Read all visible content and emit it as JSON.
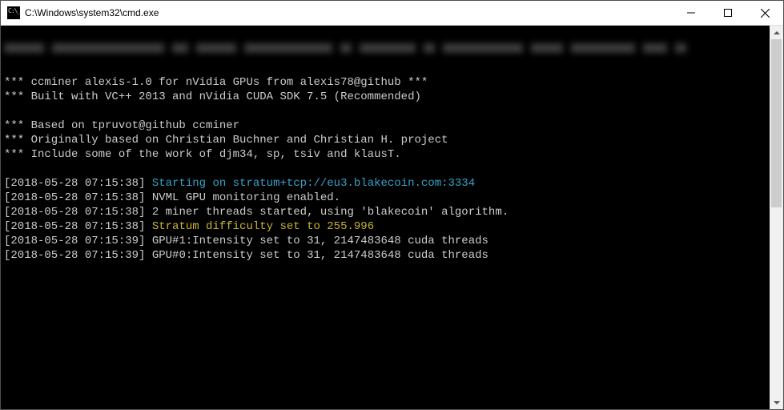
{
  "window": {
    "title": "C:\\Windows\\system32\\cmd.exe"
  },
  "banner": {
    "l1": "*** ccminer alexis-1.0 for nVidia GPUs from alexis78@github ***",
    "l2": "*** Built with VC++ 2013 and nVidia CUDA SDK 7.5 (Recommended)",
    "l3": "*** Based on tpruvot@github ccminer",
    "l4": "*** Originally based on Christian Buchner and Christian H. project",
    "l5": "*** Include some of the work of djm34, sp, tsiv and klausT."
  },
  "log": [
    {
      "ts": "[2018-05-28 07:15:38]",
      "color": "cyan",
      "msg": "Starting on stratum+tcp://eu3.blakecoin.com:3334"
    },
    {
      "ts": "[2018-05-28 07:15:38]",
      "color": "white",
      "msg": "NVML GPU monitoring enabled."
    },
    {
      "ts": "[2018-05-28 07:15:38]",
      "color": "white",
      "msg": "2 miner threads started, using 'blakecoin' algorithm."
    },
    {
      "ts": "[2018-05-28 07:15:38]",
      "color": "yellow",
      "msg": "Stratum difficulty set to 255.996"
    },
    {
      "ts": "[2018-05-28 07:15:39]",
      "color": "white",
      "msg": "GPU#1:Intensity set to 31, 2147483648 cuda threads"
    },
    {
      "ts": "[2018-05-28 07:15:39]",
      "color": "white",
      "msg": "GPU#0:Intensity set to 31, 2147483648 cuda threads"
    }
  ]
}
